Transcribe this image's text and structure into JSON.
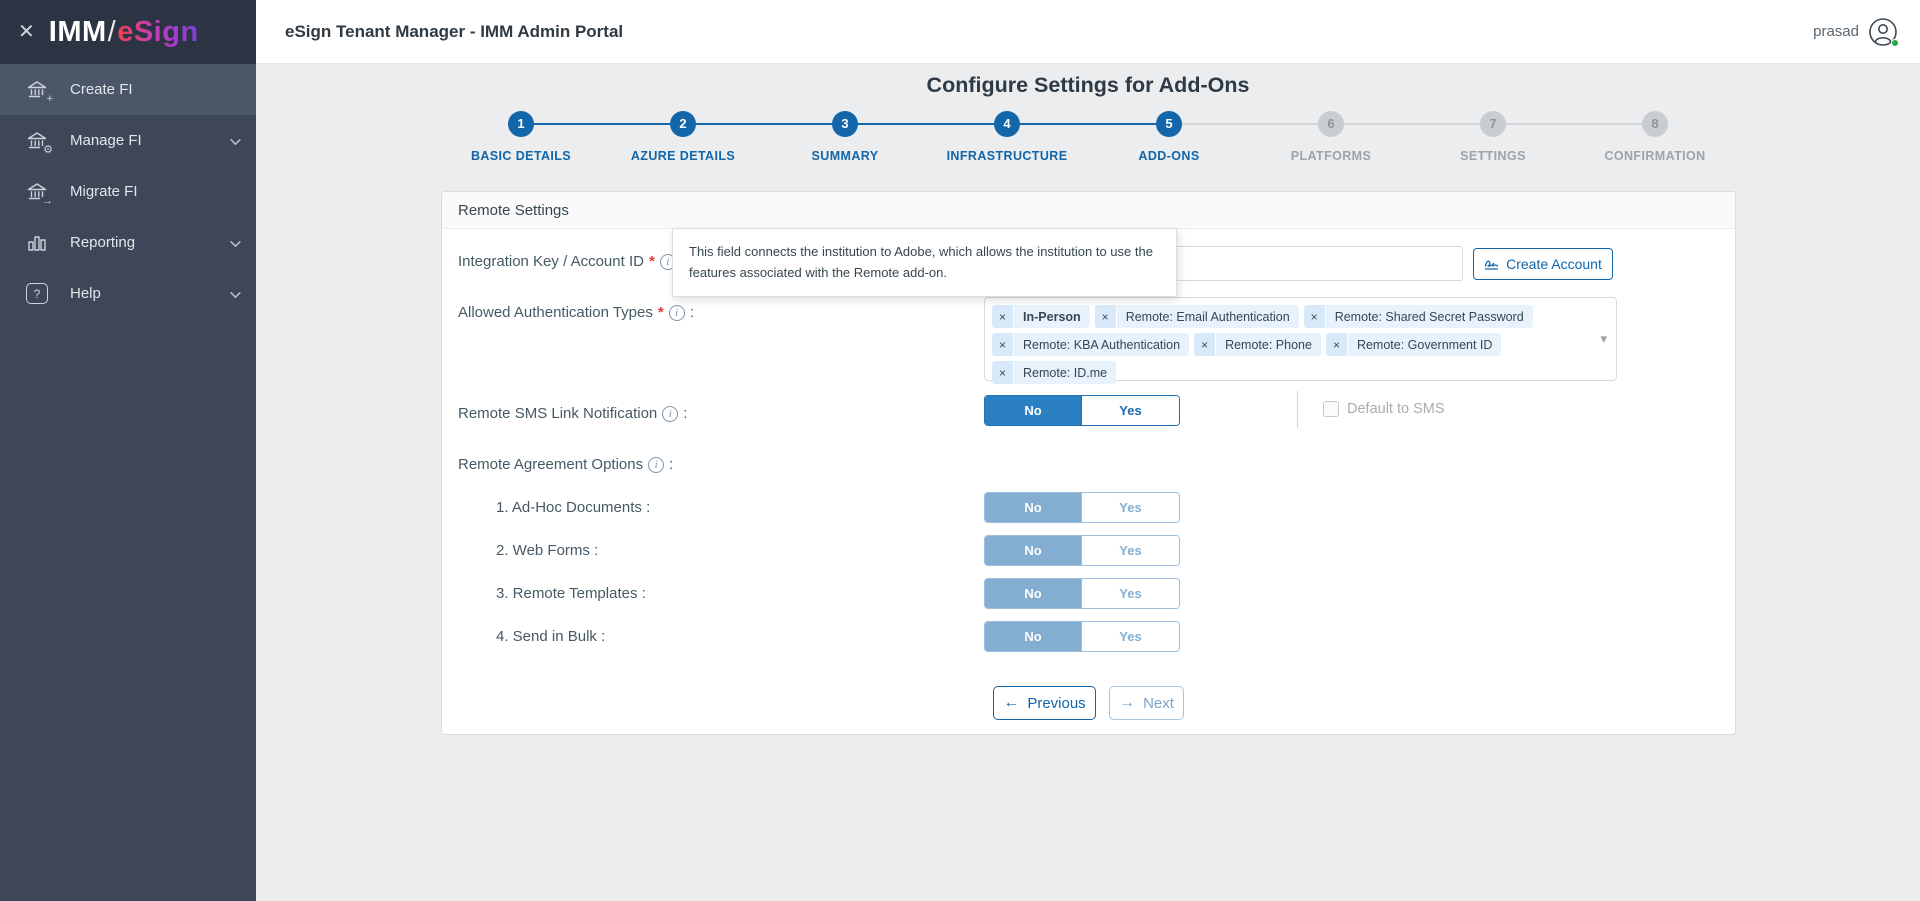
{
  "colors": {
    "accent_blue": "#1266a9",
    "toggle_blue": "#2b80c1",
    "disabled_blue": "#84add2",
    "sidebar_bg": "#3e4758",
    "sidebar_active": "#4c5669",
    "chip_bg": "#e7f2fc",
    "required_red": "#e53935",
    "online_green": "#27a744"
  },
  "ui": {
    "colon": ":",
    "asterisk": "*",
    "info_icon": "i",
    "remove_icon": "×",
    "caret_icon": "▾",
    "close_icon": "✕",
    "prev_icon": "←",
    "next_icon": "→",
    "plus_icon": "+",
    "gear_icon": "⚙",
    "migrate_icon": "→",
    "question_icon": "?"
  },
  "sidebar": {
    "logo": {
      "imm": "IMM",
      "slash": "/",
      "esign": "eSign"
    },
    "items": [
      {
        "label": "Create FI",
        "icon": "bank-plus",
        "active": true,
        "expandable": false
      },
      {
        "label": "Manage FI",
        "icon": "bank-gear",
        "active": false,
        "expandable": true
      },
      {
        "label": "Migrate FI",
        "icon": "bank-arrow",
        "active": false,
        "expandable": false
      },
      {
        "label": "Reporting",
        "icon": "bar-chart",
        "active": false,
        "expandable": true
      },
      {
        "label": "Help",
        "icon": "question-mark",
        "active": false,
        "expandable": true
      }
    ]
  },
  "header": {
    "title": "eSign Tenant Manager - IMM Admin Portal",
    "user": "prasad"
  },
  "page": {
    "title": "Configure Settings for Add-Ons"
  },
  "stepper": {
    "steps": [
      {
        "num": "1",
        "label": "BASIC DETAILS",
        "state": "completed"
      },
      {
        "num": "2",
        "label": "AZURE DETAILS",
        "state": "completed"
      },
      {
        "num": "3",
        "label": "SUMMARY",
        "state": "completed"
      },
      {
        "num": "4",
        "label": "INFRASTRUCTURE",
        "state": "completed"
      },
      {
        "num": "5",
        "label": "ADD-ONS",
        "state": "active"
      },
      {
        "num": "6",
        "label": "PLATFORMS",
        "state": "upcoming"
      },
      {
        "num": "7",
        "label": "SETTINGS",
        "state": "upcoming"
      },
      {
        "num": "8",
        "label": "CONFIRMATION",
        "state": "upcoming"
      }
    ]
  },
  "form": {
    "section_title": "Remote Settings",
    "tooltip": "This field connects the institution to Adobe, which allows the institution to use the features associated with the Remote add-on.",
    "integration": {
      "label": "Integration Key / Account ID",
      "value": "",
      "button": "Create Account"
    },
    "auth_types": {
      "label": "Allowed Authentication Types",
      "chips": [
        {
          "text": "In-Person"
        },
        {
          "text": "Remote: Email Authentication"
        },
        {
          "text": "Remote: Shared Secret Password"
        },
        {
          "text": "Remote: KBA Authentication"
        },
        {
          "text": "Remote: Phone"
        },
        {
          "text": "Remote: Government ID"
        },
        {
          "text": "Remote: ID.me"
        }
      ]
    },
    "sms": {
      "label": "Remote SMS Link Notification",
      "no": "No",
      "yes": "Yes",
      "value": "No",
      "checkbox_label": "Default to SMS",
      "checked": false
    },
    "agreement": {
      "label": "Remote Agreement Options",
      "no": "No",
      "yes": "Yes",
      "items": [
        {
          "label": "1. Ad-Hoc Documents :",
          "value": "No"
        },
        {
          "label": "2. Web Forms :",
          "value": "No"
        },
        {
          "label": "3. Remote Templates :",
          "value": "No"
        },
        {
          "label": "4. Send in Bulk :",
          "value": "No"
        }
      ]
    },
    "buttons": {
      "previous": "Previous",
      "next": "Next"
    }
  }
}
